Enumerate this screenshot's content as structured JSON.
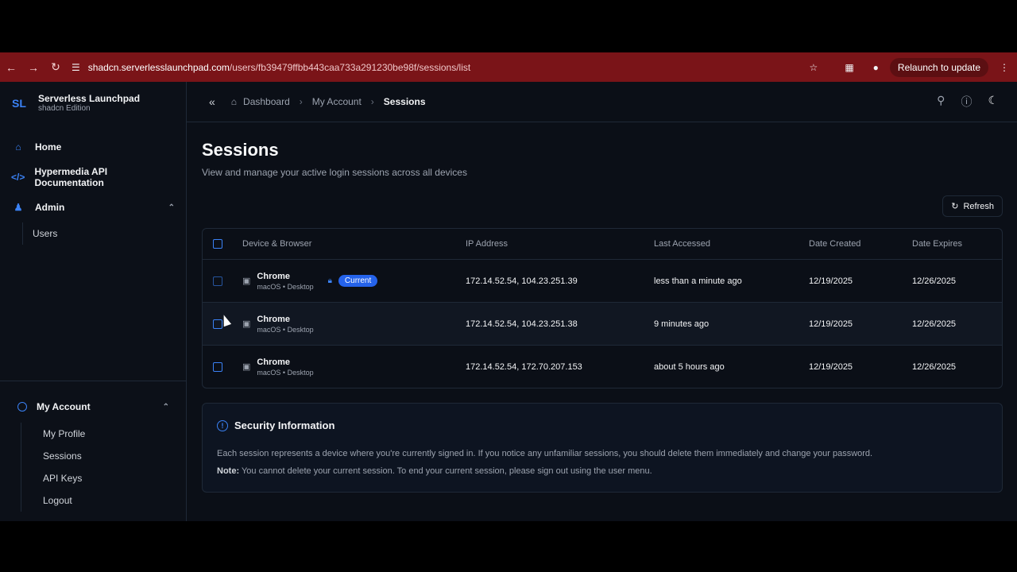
{
  "browser": {
    "url_host": "shadcn.serverlesslaunchpad.com",
    "url_path": "/users/fb39479ffbb443caa733a291230be98f/sessions/list",
    "relaunch": "Relaunch to update"
  },
  "brand": {
    "title": "Serverless Launchpad",
    "subtitle": "shadcn Edition",
    "logo": "SL"
  },
  "sidebar": {
    "items": [
      {
        "label": "Home",
        "icon": "home-icon"
      },
      {
        "label": "Hypermedia API Documentation",
        "icon": "code-icon"
      },
      {
        "label": "Admin",
        "icon": "users-icon"
      }
    ],
    "admin_sub": [
      "Users"
    ],
    "account": {
      "label": "My Account",
      "items": [
        "My Profile",
        "Sessions",
        "API Keys",
        "Logout"
      ]
    }
  },
  "breadcrumb": {
    "home": "Dashboard",
    "account": "My Account",
    "current": "Sessions"
  },
  "page": {
    "title": "Sessions",
    "subtitle": "View and manage your active login sessions across all devices",
    "refresh": "Refresh"
  },
  "table": {
    "headers": [
      "Device & Browser",
      "IP Address",
      "Last Accessed",
      "Date Created",
      "Date Expires"
    ],
    "rows": [
      {
        "browser": "Chrome",
        "device": "macOS • Desktop",
        "ip": "172.14.52.54, 104.23.251.39",
        "last": "less than a minute ago",
        "created": "12/19/2025",
        "expires": "12/26/2025",
        "badge": "Current"
      },
      {
        "browser": "Chrome",
        "device": "macOS • Desktop",
        "ip": "172.14.52.54, 104.23.251.38",
        "last": "9 minutes ago",
        "created": "12/19/2025",
        "expires": "12/26/2025"
      },
      {
        "browser": "Chrome",
        "device": "macOS • Desktop",
        "ip": "172.14.52.54, 172.70.207.153",
        "last": "about 5 hours ago",
        "created": "12/19/2025",
        "expires": "12/26/2025"
      }
    ]
  },
  "security": {
    "title": "Security Information",
    "text": "Each session represents a device where you're currently signed in. If you notice any unfamiliar sessions, you should delete them immediately and change your password.",
    "note_label": "Note:",
    "note_text": " You cannot delete your current session. To end your current session, please sign out using the user menu."
  },
  "colors": {
    "accent": "#3b82f6",
    "browser_bar": "#7a1418",
    "background": "#0b0f17"
  }
}
